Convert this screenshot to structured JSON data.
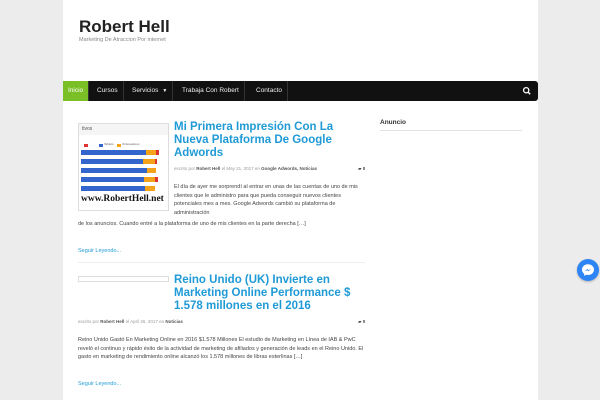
{
  "site": {
    "title": "Robert Hell",
    "description": "Marketing De Atraccion Por internet"
  },
  "nav": {
    "items": [
      {
        "label": "Inicio",
        "active": true
      },
      {
        "label": "Cursos"
      },
      {
        "label": "Servicios",
        "dropdown": true
      },
      {
        "label": "Trabaja Con Robert"
      },
      {
        "label": "Contacto"
      }
    ],
    "search_icon": "search-icon",
    "accent_color": "#7bbf27"
  },
  "posts": [
    {
      "title": "Mi Primera Impresión Con La Nueva Plataforma De Google Adwords",
      "meta_prefix": "escrito por",
      "author": "Robert Hell",
      "meta_date_prefix": "el",
      "date": "May 21, 2017",
      "meta_cat_prefix": "en",
      "categories": "Google Adwords, Noticias",
      "comments": "0",
      "excerpt_right": "El día de ayer me sorprendí al entrar en unas de las cuentas de uno de mis clientes que le administro para que pueda conseguir nuevos clientes potenciales mes a mes. Google Adwords cambió su plataforma de administración",
      "excerpt_full": "de los anuncios. Cuando entré a la plataforma de uno de mis clientes en la parte derecha […]",
      "read_more": "Seguir Leyendo...",
      "thumb_header": "tivos",
      "thumb_legend": [
        "Tablets",
        "Ordenadores"
      ],
      "thumb_watermark": "www.RobertHell.net"
    },
    {
      "title": "Reino Unido (UK) Invierte en Marketing Online Performance $ 1.578 millones en el 2016",
      "meta_prefix": "escrito por",
      "author": "Robert Hell",
      "meta_date_prefix": "el",
      "date": "April 26, 2017",
      "meta_cat_prefix": "en",
      "categories": "Noticias",
      "comments": "0",
      "excerpt": "Reino Unido Gastó En Marketing Online en 2016 $1.578 Millones El estudio de Marketing en Línea de IAB & PwC reveló el continuo y rápido éxito de la actividad de marketing de afiliados y generación de leads en el Reino Unido. El gasto en marketing de rendimiento online alcanzó los 1.578 millones de libras esterlinas […]",
      "read_more": "Seguir Leyendo..."
    }
  ],
  "sidebar": {
    "title": "Anuncio"
  },
  "messenger_icon": "messenger-icon"
}
